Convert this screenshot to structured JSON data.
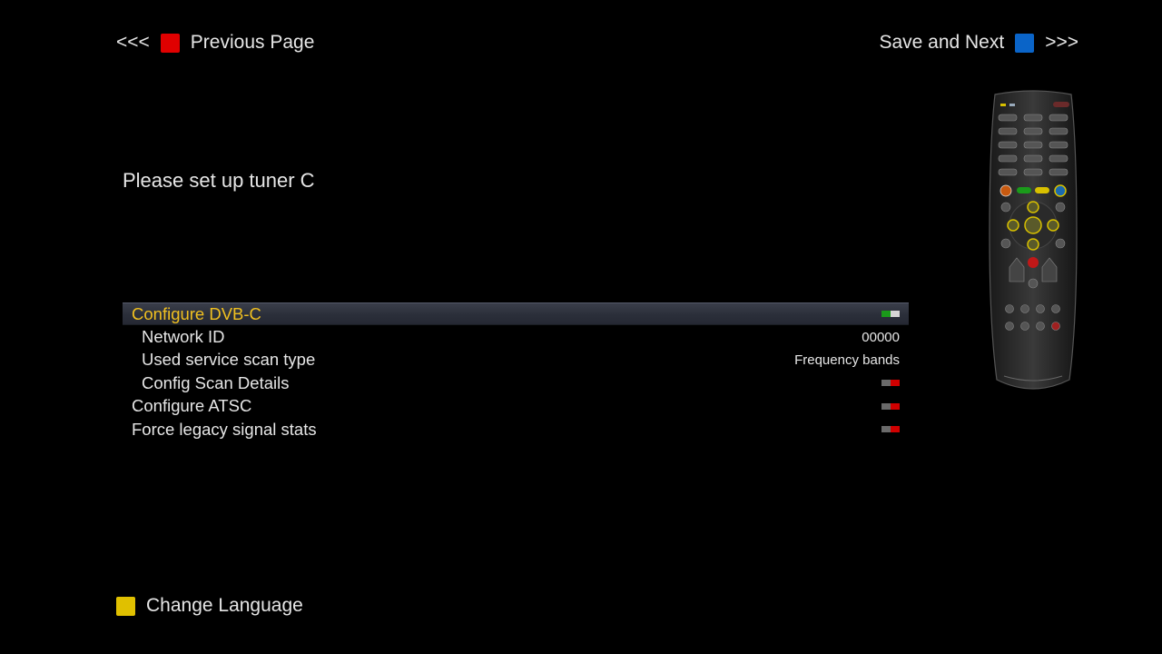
{
  "nav": {
    "prev_arrows": "<<<",
    "prev_label": "Previous Page",
    "next_label": "Save and Next",
    "next_arrows": ">>>"
  },
  "title": "Please set up tuner C",
  "menu": {
    "configure_dvbc": {
      "label": "Configure DVB-C",
      "toggle": "on"
    },
    "network_id": {
      "label": "Network ID",
      "value": "00000"
    },
    "scan_type": {
      "label": "Used service scan type",
      "value": "Frequency bands"
    },
    "scan_details": {
      "label": "Config Scan Details",
      "toggle": "off"
    },
    "configure_atsc": {
      "label": "Configure ATSC",
      "toggle": "off"
    },
    "legacy_stats": {
      "label": "Force legacy signal stats",
      "toggle": "off"
    }
  },
  "footer": {
    "change_language": "Change Language"
  },
  "colors": {
    "red_key": "#e00000",
    "blue_key": "#0a64c8",
    "yellow_key": "#e0c000",
    "selected_text": "#f0c020",
    "toggle_on": "#1a9a1a",
    "toggle_off": "#d00000"
  },
  "icons": {
    "remote": "remote-control-icon"
  }
}
